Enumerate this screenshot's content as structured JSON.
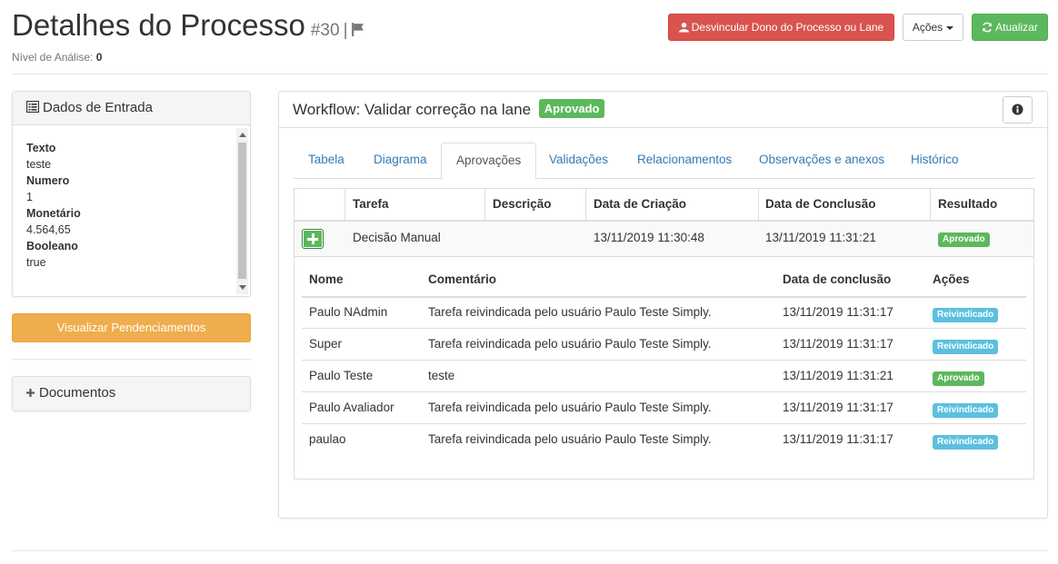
{
  "header": {
    "title": "Detalhes do Processo",
    "number": "#30",
    "separator": "|",
    "nivel_label": "Nível de Análise:",
    "nivel_value": "0",
    "buttons": {
      "unlink": "Desvincular Dono do Processo ou Lane",
      "actions": "Ações",
      "refresh": "Atualizar"
    }
  },
  "dados_entrada": {
    "title": "Dados de Entrada",
    "fields": [
      {
        "key": "Texto",
        "value": "teste"
      },
      {
        "key": "Numero",
        "value": "1"
      },
      {
        "key": "Monetário",
        "value": "4.564,65"
      },
      {
        "key": "Booleano",
        "value": "true"
      }
    ]
  },
  "visualizar_button": "Visualizar Pendenciamentos",
  "documentos_title": "Documentos",
  "workflow": {
    "title": "Workflow: Validar correção na lane",
    "status": "Aprovado",
    "tabs": [
      "Tabela",
      "Diagrama",
      "Aprovações",
      "Validações",
      "Relacionamentos",
      "Observações e anexos",
      "Histórico"
    ],
    "active_tab": "Aprovações",
    "table": {
      "headers": [
        "Tarefa",
        "Descrição",
        "Data de Criação",
        "Data de Conclusão",
        "Resultado"
      ],
      "row": {
        "tarefa": "Decisão Manual",
        "descricao": "",
        "criacao": "13/11/2019 11:30:48",
        "conclusao": "13/11/2019 11:31:21",
        "resultado": "Aprovado"
      }
    },
    "approvals": {
      "headers": [
        "Nome",
        "Comentário",
        "Data de conclusão",
        "Ações"
      ],
      "rows": [
        {
          "nome": "Paulo NAdmin",
          "comentario": "Tarefa reivindicada pelo usuário Paulo Teste Simply.",
          "data": "13/11/2019 11:31:17",
          "acao": "Reivindicado",
          "tipo": "info"
        },
        {
          "nome": "Super",
          "comentario": "Tarefa reivindicada pelo usuário Paulo Teste Simply.",
          "data": "13/11/2019 11:31:17",
          "acao": "Reivindicado",
          "tipo": "info"
        },
        {
          "nome": "Paulo Teste",
          "comentario": "teste",
          "data": "13/11/2019 11:31:21",
          "acao": "Aprovado",
          "tipo": "success"
        },
        {
          "nome": "Paulo Avaliador",
          "comentario": "Tarefa reivindicada pelo usuário Paulo Teste Simply.",
          "data": "13/11/2019 11:31:17",
          "acao": "Reivindicado",
          "tipo": "info"
        },
        {
          "nome": "paulao",
          "comentario": "Tarefa reivindicada pelo usuário Paulo Teste Simply.",
          "data": "13/11/2019 11:31:17",
          "acao": "Reivindicado",
          "tipo": "info"
        }
      ]
    }
  },
  "colors": {
    "danger": "#d9534f",
    "success": "#5cb85c",
    "warning": "#f0ad4e",
    "info": "#5bc0de",
    "link": "#337ab7"
  },
  "icons": [
    "flag-icon",
    "user-icon",
    "refresh-icon",
    "list-icon",
    "plus-icon",
    "info-circle-icon",
    "expand-plus-icon"
  ]
}
